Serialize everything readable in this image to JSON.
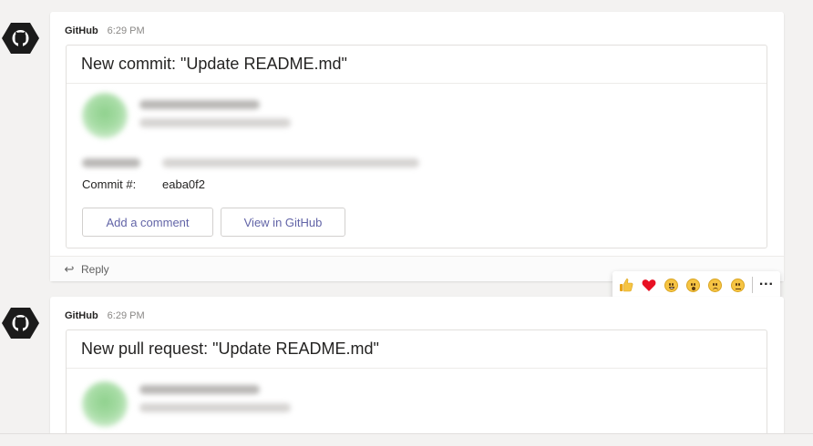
{
  "messages": [
    {
      "sender": "GitHub",
      "time": "6:29 PM",
      "card_title": "New commit: \"Update README.md\"",
      "facts": [
        {
          "label": "Commit #:",
          "value": "eaba0f2"
        }
      ],
      "actions": [
        "Add a comment",
        "View in GitHub"
      ],
      "reply_label": "Reply"
    },
    {
      "sender": "GitHub",
      "time": "6:29 PM",
      "card_title": "New pull request: \"Update README.md\""
    }
  ],
  "reactions": [
    "like",
    "heart",
    "laugh",
    "surprised",
    "sad",
    "angry"
  ],
  "icons": {
    "avatar": "github-octocat-icon",
    "reply": "reply-arrow-icon",
    "more": "more-options-icon"
  },
  "colors": {
    "accent": "#6264a7",
    "background": "#f3f2f1",
    "card_border": "#e1dfdd"
  }
}
